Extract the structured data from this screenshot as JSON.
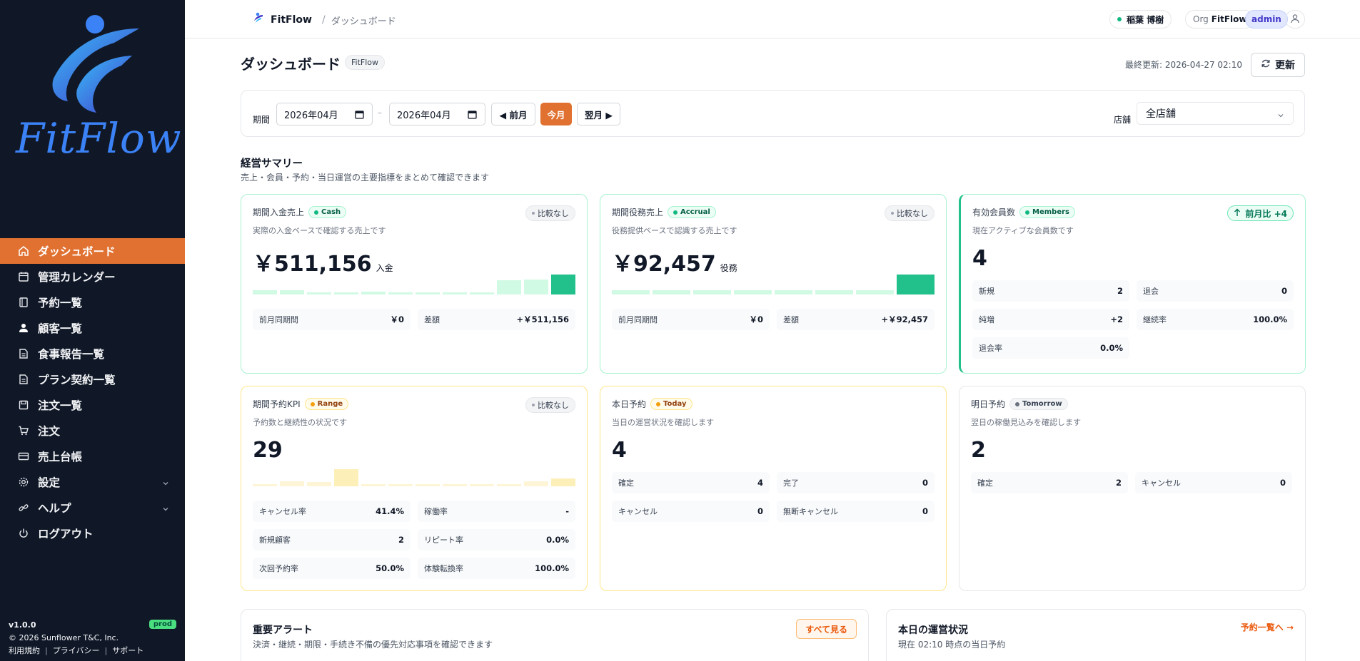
{
  "sidebar": {
    "logo_text": "FitFlow",
    "items": [
      {
        "label": "ダッシュボード",
        "icon": "home-icon",
        "active": true
      },
      {
        "label": "管理カレンダー",
        "icon": "calendar-icon"
      },
      {
        "label": "予約一覧",
        "icon": "book-icon"
      },
      {
        "label": "顧客一覧",
        "icon": "user-icon"
      },
      {
        "label": "食事報告一覧",
        "icon": "document-icon"
      },
      {
        "label": "プラン契約一覧",
        "icon": "document-icon"
      },
      {
        "label": "注文一覧",
        "icon": "save-icon"
      },
      {
        "label": "注文",
        "icon": "cart-icon"
      },
      {
        "label": "売上台帳",
        "icon": "credit-card-icon"
      },
      {
        "label": "設定",
        "icon": "gear-icon",
        "expandable": true
      },
      {
        "label": "ヘルプ",
        "icon": "link-icon",
        "expandable": true
      },
      {
        "label": "ログアウト",
        "icon": "power-icon"
      }
    ],
    "footer": {
      "version": "v1.0.0",
      "env": "prod",
      "copyright": "© 2026 Sunflower T&C, Inc.",
      "links": [
        "利用規約",
        "プライバシー",
        "サポート"
      ]
    }
  },
  "header": {
    "brand": "FitFlow",
    "breadcrumb": "ダッシュボード",
    "user": "稲葉 博樹",
    "org_label": "Org",
    "org_value": "FitFlow",
    "role": "admin"
  },
  "page": {
    "title": "ダッシュボード",
    "title_tag": "FitFlow",
    "last_updated": "最終更新: 2026-04-27 02:10",
    "refresh_label": "更新"
  },
  "filter": {
    "period_label": "期間",
    "date_from": "2026年04月",
    "date_to": "2026年04月",
    "dash": "–",
    "prev_label": "◀ 前月",
    "this_label": "今月",
    "next_label": "翌月 ▶",
    "store_label": "店舗",
    "store_value": "全店舗"
  },
  "summary": {
    "title": "経営サマリー",
    "subtitle": "売上・会員・予約・当日運営の主要指標をまとめて確認できます"
  },
  "cards": {
    "cash": {
      "name": "期間入金売上",
      "tag": "Cash",
      "compare": "比較なし",
      "desc": "実際の入金ベースで確認する売上です",
      "value": "￥511,156",
      "unit": "入金",
      "bars": [
        0.22,
        0.22,
        0.05,
        0.12,
        0.16,
        0.05,
        0.05,
        0.05,
        0.05,
        0.7,
        0.75,
        1.0
      ],
      "stats": [
        {
          "k": "前月同期間",
          "v": "￥0"
        },
        {
          "k": "差額",
          "v": "+￥511,156"
        }
      ]
    },
    "accrual": {
      "name": "期間役務売上",
      "tag": "Accrual",
      "compare": "比較なし",
      "desc": "役務提供ベースで認識する売上です",
      "value": "￥92,457",
      "unit": "役務",
      "bars": [
        0.22,
        0.22,
        0.22,
        0.22,
        0.22,
        0.22,
        0.22,
        1.0
      ],
      "stats": [
        {
          "k": "前月同期間",
          "v": "￥0"
        },
        {
          "k": "差額",
          "v": "+￥92,457"
        }
      ]
    },
    "members": {
      "name": "有効会員数",
      "tag": "Members",
      "compare": "前月比 +4",
      "desc": "現在アクティブな会員数です",
      "value": "4",
      "stats": [
        {
          "k": "新規",
          "v": "2"
        },
        {
          "k": "退会",
          "v": "0"
        },
        {
          "k": "純増",
          "v": "+2"
        },
        {
          "k": "継続率",
          "v": "100.0%"
        },
        {
          "k": "退会率",
          "v": "0.0%"
        }
      ]
    },
    "range": {
      "name": "期間予約KPI",
      "tag": "Range",
      "compare": "比較なし",
      "desc": "予約数と継続性の状況です",
      "value": "29",
      "bars": [
        0.1,
        0.25,
        0.2,
        0.85,
        0.05,
        0.05,
        0.05,
        0.05,
        0.05,
        0.05,
        0.25,
        0.38
      ],
      "stats": [
        {
          "k": "キャンセル率",
          "v": "41.4%"
        },
        {
          "k": "稼働率",
          "v": "-"
        },
        {
          "k": "新規顧客",
          "v": "2"
        },
        {
          "k": "リピート率",
          "v": "0.0%"
        },
        {
          "k": "次回予約率",
          "v": "50.0%"
        },
        {
          "k": "体験転換率",
          "v": "100.0%"
        }
      ]
    },
    "today": {
      "name": "本日予約",
      "tag": "Today",
      "desc": "当日の運営状況を確認します",
      "value": "4",
      "stats": [
        {
          "k": "確定",
          "v": "4"
        },
        {
          "k": "完了",
          "v": "0"
        },
        {
          "k": "キャンセル",
          "v": "0"
        },
        {
          "k": "無断キャンセル",
          "v": "0"
        }
      ]
    },
    "tomorrow": {
      "name": "明日予約",
      "tag": "Tomorrow",
      "desc": "翌日の稼働見込みを確認します",
      "value": "2",
      "stats": [
        {
          "k": "確定",
          "v": "2"
        },
        {
          "k": "キャンセル",
          "v": "0"
        }
      ]
    }
  },
  "alerts": {
    "title": "重要アラート",
    "subtitle": "決済・継続・期限・手続き不備の優先対応事項を確認できます",
    "link": "すべて見る"
  },
  "ops": {
    "title": "本日の運営状況",
    "subtitle": "現在 02:10 時点の当日予約",
    "link": "予約一覧へ →"
  },
  "colors": {
    "accent": "#e07131",
    "sidebar_bg": "#101828",
    "green": "#22c08a",
    "yellow": "#f5a623"
  }
}
